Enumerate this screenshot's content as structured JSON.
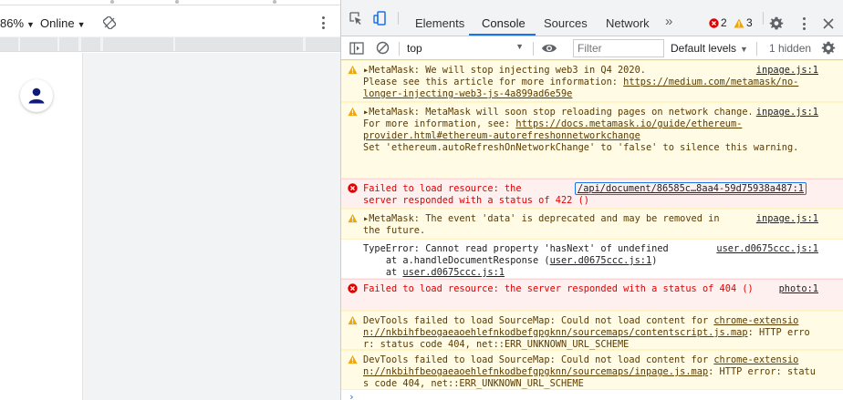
{
  "viewport": {
    "zoom": "86%",
    "network": "Online"
  },
  "devtools": {
    "tabs": [
      "Elements",
      "Console",
      "Sources",
      "Network"
    ],
    "more_tabs": "»",
    "errors_count": "2",
    "warnings_count": "3",
    "toolbar": {
      "context": "top",
      "filter_placeholder": "Filter",
      "levels": "Default levels",
      "hidden": "1 hidden"
    }
  },
  "messages": [
    {
      "level": "warning",
      "lines": [
        "▸MetaMask: We will stop injecting web3 in Q4 2020.",
        "Please see this article for more information: ",
        "https://medium.com/metamask/no-longer-injecting-web3-js-4a899ad6e59e"
      ],
      "source": "inpage.js:1"
    },
    {
      "level": "warning",
      "lines": [
        "▸MetaMask: MetaMask will soon stop reloading pages on network change.",
        "For more information, see: ",
        "https://docs.metamask.io/guide/ethereum-provider.html#ethereum-autorefreshonnetworkchange",
        "Set 'ethereum.autoRefreshOnNetworkChange' to 'false' to silence this warning."
      ],
      "source": "inpage.js:1"
    },
    {
      "level": "error",
      "lines": [
        "Failed to load resource: the",
        "server responded with a status of 422 ()"
      ],
      "source": "/api/document/86585c…8aa4-59d75938a487:1"
    },
    {
      "level": "warning",
      "lines": [
        "▸MetaMask: The event 'data' is deprecated and may be removed in the future."
      ],
      "source": "inpage.js:1"
    },
    {
      "level": "info",
      "lines": [
        "TypeError: Cannot read property 'hasNext' of undefined",
        "    at a.handleDocumentResponse (",
        "user.d0675ccc.js:1",
        ")",
        "    at ",
        "user.d0675ccc.js:1"
      ],
      "source": "user.d0675ccc.js:1"
    },
    {
      "level": "error",
      "lines": [
        "Failed to load resource: the server responded with a status of 404 ()"
      ],
      "source": "photo:1"
    },
    {
      "level": "warning",
      "lines": [
        "DevTools failed to load SourceMap: Could not load content for ",
        "chrome-extension://nkbihfbeogaeaoehlefnkodbefgpgknn/sourcemaps/contentscript.js.map",
        ": HTTP error: status code 404, net::ERR_UNKNOWN_URL_SCHEME"
      ]
    },
    {
      "level": "warning",
      "lines": [
        "DevTools failed to load SourceMap: Could not load content for ",
        "chrome-extension://nkbihfbeogaeaoehlefnkodbefgpgknn/sourcemaps/inpage.js.map",
        ": HTTP error: status code 404, net::ERR_UNKNOWN_URL_SCHEME"
      ]
    }
  ],
  "prompt": "›",
  "colors": {
    "accent": "#1a73e8",
    "warning_bg": "#fffbe5",
    "warning_text": "#5c3c00",
    "error_bg": "#fff0f0",
    "error_text": "#e00000",
    "avatar": "#0d1a7a"
  }
}
